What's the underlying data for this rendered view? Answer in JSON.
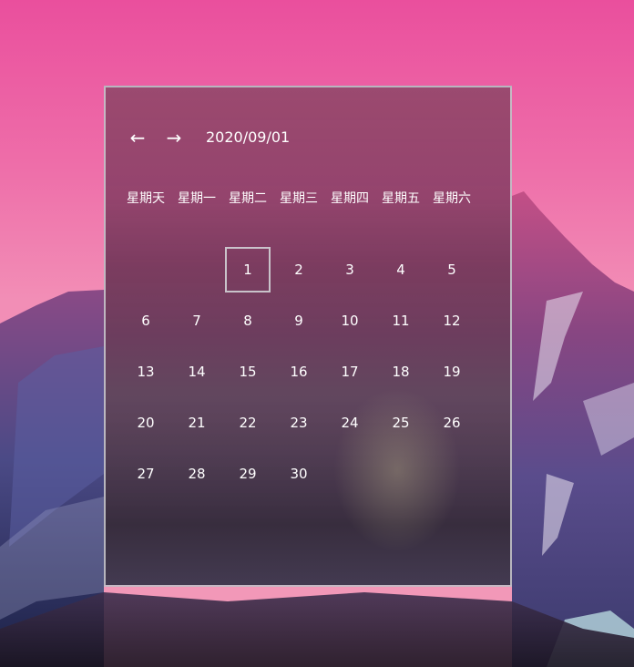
{
  "calendar": {
    "current_date": "2020/09/01",
    "prev_icon": "←",
    "next_icon": "→",
    "weekdays": [
      "星期天",
      "星期一",
      "星期二",
      "星期三",
      "星期四",
      "星期五",
      "星期六"
    ],
    "leading_blanks": 2,
    "days": [
      "1",
      "2",
      "3",
      "4",
      "5",
      "6",
      "7",
      "8",
      "9",
      "10",
      "11",
      "12",
      "13",
      "14",
      "15",
      "16",
      "17",
      "18",
      "19",
      "20",
      "21",
      "22",
      "23",
      "24",
      "25",
      "26",
      "27",
      "28",
      "29",
      "30"
    ],
    "selected_day": "1"
  }
}
